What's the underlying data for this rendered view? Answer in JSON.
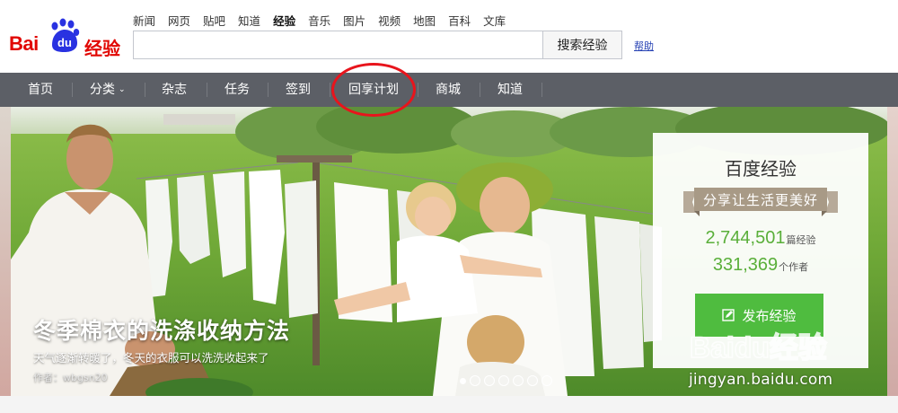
{
  "brand": {
    "logo_text": "Bai",
    "logo_du": "du",
    "logo_cn": "经验"
  },
  "top_nav": [
    "新闻",
    "网页",
    "贴吧",
    "知道",
    "经验",
    "音乐",
    "图片",
    "视频",
    "地图",
    "百科",
    "文库"
  ],
  "top_nav_active": "经验",
  "search": {
    "value": "",
    "placeholder": "",
    "button_label": "搜索经验"
  },
  "help_link": "帮助",
  "main_nav": {
    "home": "首页",
    "category": "分类",
    "magazine": "杂志",
    "tasks": "任务",
    "checkin": "签到",
    "share_plan": "回享计划",
    "mall": "商城",
    "zhidao": "知道"
  },
  "hero": {
    "title": "冬季棉衣的洗涤收纳方法",
    "subtitle": "天气逐渐转暖了，冬天的衣服可以洗洗收起来了",
    "author": "作者：wbgsn20",
    "slide_count": 7,
    "active_slide": 1
  },
  "card": {
    "title": "百度经验",
    "ribbon": "分享让生活更美好",
    "articles_count": "2,744,501",
    "articles_unit": "篇经验",
    "authors_count": "331,369",
    "authors_unit": "个作者",
    "publish_label": "发布经验",
    "footer": "发布经验"
  },
  "watermark": {
    "brand": "Baidu经验",
    "url": "jingyan.baidu.com"
  },
  "colors": {
    "brand_red": "#e10602",
    "nav_bg": "#5c5f66",
    "accent_green": "#4fbc3f",
    "highlight_red": "#e8141c"
  }
}
